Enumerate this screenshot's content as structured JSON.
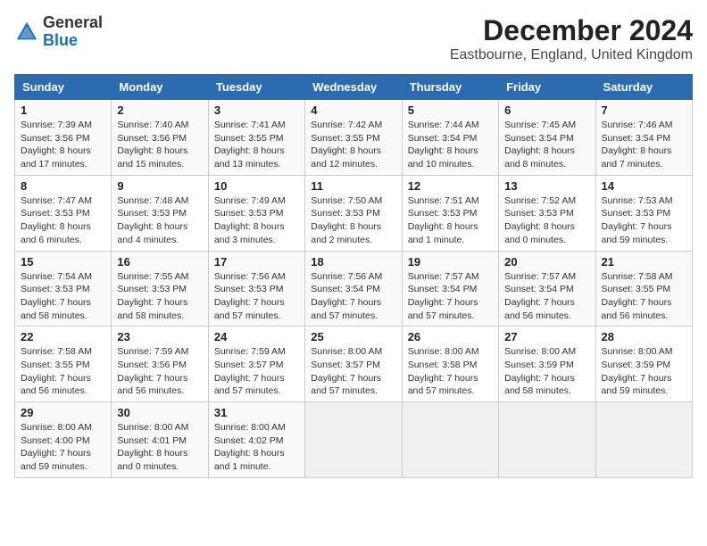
{
  "header": {
    "logo_general": "General",
    "logo_blue": "Blue",
    "month_year": "December 2024",
    "location": "Eastbourne, England, United Kingdom"
  },
  "weekdays": [
    "Sunday",
    "Monday",
    "Tuesday",
    "Wednesday",
    "Thursday",
    "Friday",
    "Saturday"
  ],
  "weeks": [
    [
      {
        "day": "1",
        "sunrise": "7:39 AM",
        "sunset": "3:56 PM",
        "daylight": "8 hours and 17 minutes."
      },
      {
        "day": "2",
        "sunrise": "7:40 AM",
        "sunset": "3:56 PM",
        "daylight": "8 hours and 15 minutes."
      },
      {
        "day": "3",
        "sunrise": "7:41 AM",
        "sunset": "3:55 PM",
        "daylight": "8 hours and 13 minutes."
      },
      {
        "day": "4",
        "sunrise": "7:42 AM",
        "sunset": "3:55 PM",
        "daylight": "8 hours and 12 minutes."
      },
      {
        "day": "5",
        "sunrise": "7:44 AM",
        "sunset": "3:54 PM",
        "daylight": "8 hours and 10 minutes."
      },
      {
        "day": "6",
        "sunrise": "7:45 AM",
        "sunset": "3:54 PM",
        "daylight": "8 hours and 8 minutes."
      },
      {
        "day": "7",
        "sunrise": "7:46 AM",
        "sunset": "3:54 PM",
        "daylight": "8 hours and 7 minutes."
      }
    ],
    [
      {
        "day": "8",
        "sunrise": "7:47 AM",
        "sunset": "3:53 PM",
        "daylight": "8 hours and 6 minutes."
      },
      {
        "day": "9",
        "sunrise": "7:48 AM",
        "sunset": "3:53 PM",
        "daylight": "8 hours and 4 minutes."
      },
      {
        "day": "10",
        "sunrise": "7:49 AM",
        "sunset": "3:53 PM",
        "daylight": "8 hours and 3 minutes."
      },
      {
        "day": "11",
        "sunrise": "7:50 AM",
        "sunset": "3:53 PM",
        "daylight": "8 hours and 2 minutes."
      },
      {
        "day": "12",
        "sunrise": "7:51 AM",
        "sunset": "3:53 PM",
        "daylight": "8 hours and 1 minute."
      },
      {
        "day": "13",
        "sunrise": "7:52 AM",
        "sunset": "3:53 PM",
        "daylight": "8 hours and 0 minutes."
      },
      {
        "day": "14",
        "sunrise": "7:53 AM",
        "sunset": "3:53 PM",
        "daylight": "7 hours and 59 minutes."
      }
    ],
    [
      {
        "day": "15",
        "sunrise": "7:54 AM",
        "sunset": "3:53 PM",
        "daylight": "7 hours and 58 minutes."
      },
      {
        "day": "16",
        "sunrise": "7:55 AM",
        "sunset": "3:53 PM",
        "daylight": "7 hours and 58 minutes."
      },
      {
        "day": "17",
        "sunrise": "7:56 AM",
        "sunset": "3:53 PM",
        "daylight": "7 hours and 57 minutes."
      },
      {
        "day": "18",
        "sunrise": "7:56 AM",
        "sunset": "3:54 PM",
        "daylight": "7 hours and 57 minutes."
      },
      {
        "day": "19",
        "sunrise": "7:57 AM",
        "sunset": "3:54 PM",
        "daylight": "7 hours and 57 minutes."
      },
      {
        "day": "20",
        "sunrise": "7:57 AM",
        "sunset": "3:54 PM",
        "daylight": "7 hours and 56 minutes."
      },
      {
        "day": "21",
        "sunrise": "7:58 AM",
        "sunset": "3:55 PM",
        "daylight": "7 hours and 56 minutes."
      }
    ],
    [
      {
        "day": "22",
        "sunrise": "7:58 AM",
        "sunset": "3:55 PM",
        "daylight": "7 hours and 56 minutes."
      },
      {
        "day": "23",
        "sunrise": "7:59 AM",
        "sunset": "3:56 PM",
        "daylight": "7 hours and 56 minutes."
      },
      {
        "day": "24",
        "sunrise": "7:59 AM",
        "sunset": "3:57 PM",
        "daylight": "7 hours and 57 minutes."
      },
      {
        "day": "25",
        "sunrise": "8:00 AM",
        "sunset": "3:57 PM",
        "daylight": "7 hours and 57 minutes."
      },
      {
        "day": "26",
        "sunrise": "8:00 AM",
        "sunset": "3:58 PM",
        "daylight": "7 hours and 57 minutes."
      },
      {
        "day": "27",
        "sunrise": "8:00 AM",
        "sunset": "3:59 PM",
        "daylight": "7 hours and 58 minutes."
      },
      {
        "day": "28",
        "sunrise": "8:00 AM",
        "sunset": "3:59 PM",
        "daylight": "7 hours and 59 minutes."
      }
    ],
    [
      {
        "day": "29",
        "sunrise": "8:00 AM",
        "sunset": "4:00 PM",
        "daylight": "7 hours and 59 minutes."
      },
      {
        "day": "30",
        "sunrise": "8:00 AM",
        "sunset": "4:01 PM",
        "daylight": "8 hours and 0 minutes."
      },
      {
        "day": "31",
        "sunrise": "8:00 AM",
        "sunset": "4:02 PM",
        "daylight": "8 hours and 1 minute."
      },
      null,
      null,
      null,
      null
    ]
  ]
}
